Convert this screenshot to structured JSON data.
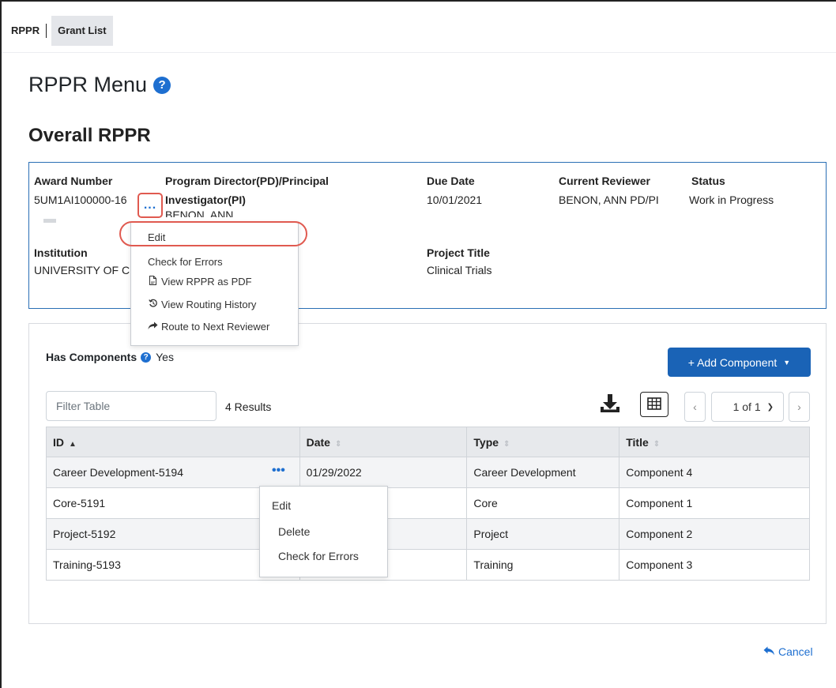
{
  "nav": {
    "rppr": "RPPR",
    "grant_list": "Grant List"
  },
  "page": {
    "title": "RPPR Menu",
    "help_glyph": "?",
    "section": "Overall RPPR"
  },
  "overall": {
    "award_number_label": "Award Number",
    "award_number": "5UM1AI100000-16",
    "pd_label_1": "Program Director(PD)/Principal",
    "pd_label_2": "Investigator(PI)",
    "pd_value": "BENON, ANN",
    "due_date_label": "Due Date",
    "due_date": "10/01/2021",
    "reviewer_label": "Current Reviewer",
    "reviewer": "BENON, ANN PD/PI",
    "status_label": "Status",
    "status": "Work in Progress",
    "institution_label": "Institution",
    "institution": "UNIVERSITY OF C",
    "project_title_label": "Project Title",
    "project_title": "Clinical Trials"
  },
  "actions_menu": {
    "trigger": "...",
    "items": [
      "Edit",
      "Check for Errors",
      "View RPPR as PDF",
      "View Routing History",
      "Route to Next Reviewer"
    ]
  },
  "components": {
    "has_components_label": "Has Components",
    "has_components_value": "Yes",
    "add_button": "+ Add Component",
    "filter_placeholder": "Filter Table",
    "results": "4 Results",
    "page_indicator": "1 of 1",
    "columns": [
      "ID",
      "Date",
      "Type",
      "Title"
    ],
    "rows": [
      [
        "Career Development-5194",
        "01/29/2022",
        "Career Development",
        "Component 4"
      ],
      [
        "Core-5191",
        "",
        "Core",
        "Component 1"
      ],
      [
        "Project-5192",
        "",
        "Project",
        "Component 2"
      ],
      [
        "Training-5193",
        "",
        "Training",
        "Component 3"
      ]
    ],
    "row_menu": [
      "Edit",
      "Delete",
      "Check for Errors"
    ]
  },
  "footer": {
    "cancel": "Cancel"
  },
  "colors": {
    "primary": "#1a63b6",
    "link": "#1e6fd0",
    "highlight": "#e05a50",
    "panel_border": "#2a6fb5"
  },
  "icons": [
    "help-icon",
    "ellipsis-icon",
    "pdf-icon",
    "history-icon",
    "share-icon",
    "download-icon",
    "grid-icon",
    "chevron-left-icon",
    "chevron-down-icon",
    "chevron-right-icon",
    "reply-icon"
  ]
}
